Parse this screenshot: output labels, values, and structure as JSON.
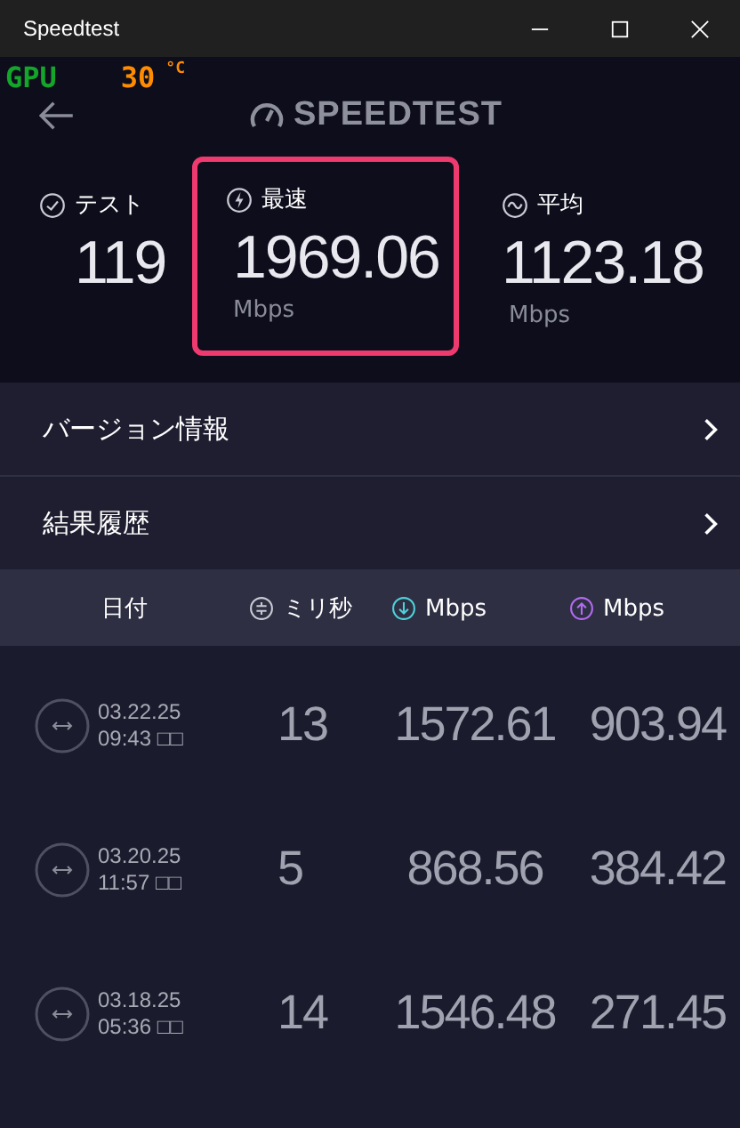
{
  "window": {
    "title": "Speedtest"
  },
  "overlay": {
    "label": "GPU",
    "value": "30",
    "unit": "°C"
  },
  "header": {
    "logo": "SPEEDTEST"
  },
  "stats": [
    {
      "kind": "tests",
      "label": "テスト",
      "value": "119",
      "selected": false
    },
    {
      "kind": "max",
      "label": "最速",
      "value": "1969.06",
      "unit": "Mbps",
      "selected": true
    },
    {
      "kind": "avg",
      "label": "平均",
      "value": "1123.18",
      "unit": "Mbps",
      "selected": false
    }
  ],
  "menu": [
    {
      "label": "バージョン情報"
    },
    {
      "label": "結果履歴"
    }
  ],
  "table": {
    "columns": [
      {
        "kind": "date",
        "label": "日付"
      },
      {
        "kind": "ping",
        "label": "ミリ秒"
      },
      {
        "kind": "down",
        "label": "Mbps"
      },
      {
        "kind": "up",
        "label": "Mbps"
      }
    ],
    "rows": [
      {
        "date": "03.22.25",
        "time": "09:43 □□",
        "ping": "13",
        "down": "1572.61",
        "up": "903.94"
      },
      {
        "date": "03.20.25",
        "time": "11:57 □□",
        "ping": "5",
        "down": "868.56",
        "up": "384.42"
      },
      {
        "date": "03.18.25",
        "time": "05:36 □□",
        "ping": "14",
        "down": "1546.48",
        "up": "271.45"
      }
    ]
  }
}
